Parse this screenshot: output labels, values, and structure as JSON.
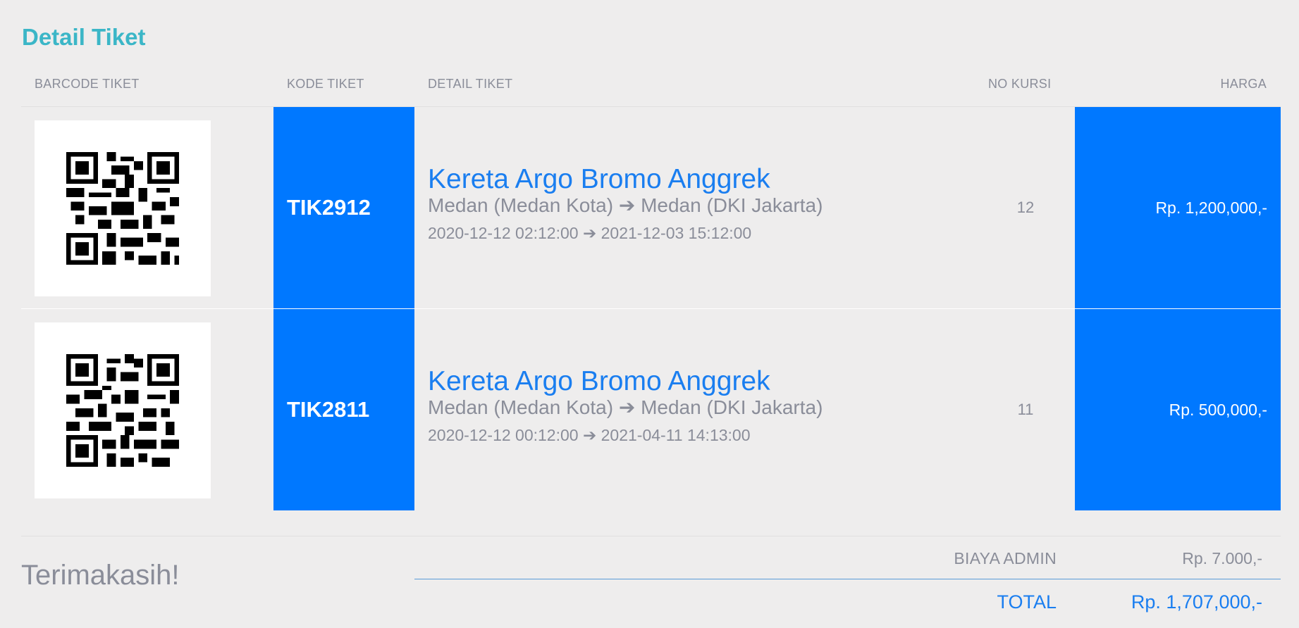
{
  "title": "Detail Tiket",
  "columns": {
    "barcode": "BARCODE TIKET",
    "code": "KODE TIKET",
    "detail": "DETAIL TIKET",
    "seat": "NO KURSI",
    "price": "HARGA"
  },
  "tickets": [
    {
      "code": "TIK2912",
      "train": "Kereta Argo Bromo Anggrek",
      "origin": "Medan (Medan Kota)",
      "destination": "Medan (DKI Jakarta)",
      "departure": "2020-12-12 02:12:00",
      "arrival": "2021-12-03 15:12:00",
      "seat": "12",
      "price": "Rp. 1,200,000,-",
      "barcode_icon": "qr-code-icon"
    },
    {
      "code": "TIK2811",
      "train": "Kereta Argo Bromo Anggrek",
      "origin": "Medan (Medan Kota)",
      "destination": "Medan (DKI Jakarta)",
      "departure": "2020-12-12 00:12:00",
      "arrival": "2021-04-11 14:13:00",
      "seat": "11",
      "price": "Rp. 500,000,-",
      "barcode_icon": "qr-code-icon"
    }
  ],
  "footer": {
    "thanks": "Terimakasih!",
    "admin_fee_label": "BIAYA ADMIN",
    "admin_fee_value": "Rp. 7.000,-",
    "total_label": "TOTAL",
    "total_value": "Rp. 1,707,000,-"
  },
  "colors": {
    "accent": "#0078ff",
    "title": "#3bb6c7",
    "muted": "#8a8d99",
    "background": "#eeeded"
  }
}
